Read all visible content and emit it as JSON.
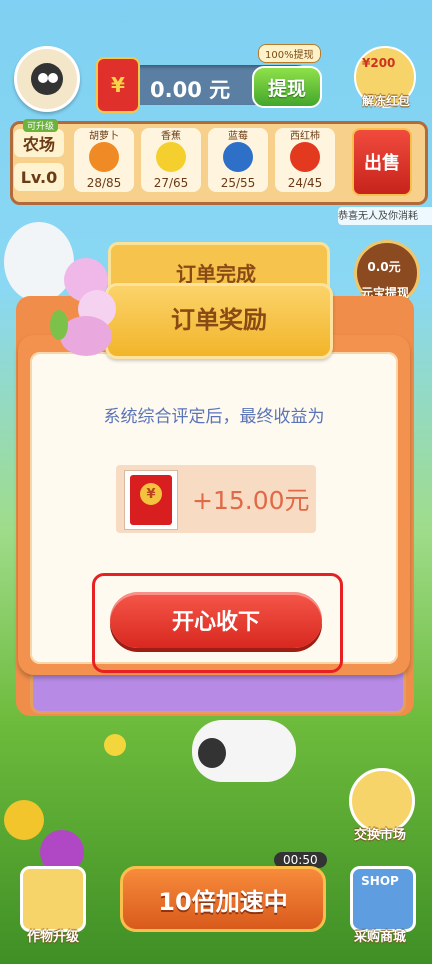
{
  "header": {
    "balance": "0.00 元",
    "withdraw_label": "提现",
    "withdraw_badge": "100%提现",
    "unfreeze_amount": "¥200",
    "unfreeze_label": "解冻红包"
  },
  "farm": {
    "upgradable_label": "可升级",
    "name": "农场",
    "level": "Lv.0",
    "crops": [
      {
        "name": "胡萝卜",
        "count": "28/85",
        "color": "#f08a24"
      },
      {
        "name": "香蕉",
        "count": "27/65",
        "color": "#f4cf2e"
      },
      {
        "name": "蓝莓",
        "count": "25/55",
        "color": "#2e6fc7"
      },
      {
        "name": "西红柿",
        "count": "24/45",
        "color": "#e33a1f"
      }
    ],
    "sell_label": "出售",
    "ticker": "恭喜无人及你消耗"
  },
  "background_panel": {
    "title": "订单完成",
    "withdraw_value": "0.0元",
    "withdraw_label": "元宝提现"
  },
  "dialog": {
    "title": "订单奖励",
    "description": "系统综合评定后，最终收益为",
    "reward_value": "+15.00元",
    "coin_symbol": "¥",
    "cta_label": "开心收下"
  },
  "bottom": {
    "exchange_label": "交换市场",
    "timer": "00:50",
    "boost_label": "10倍加速中",
    "crop_upgrade_label": "作物升级",
    "shop_icon_text": "SHOP",
    "shop_label": "采购商城"
  },
  "colors": {
    "cta": "#e0392c",
    "highlight": "#e72121",
    "dialog_border": "#f3924f"
  }
}
